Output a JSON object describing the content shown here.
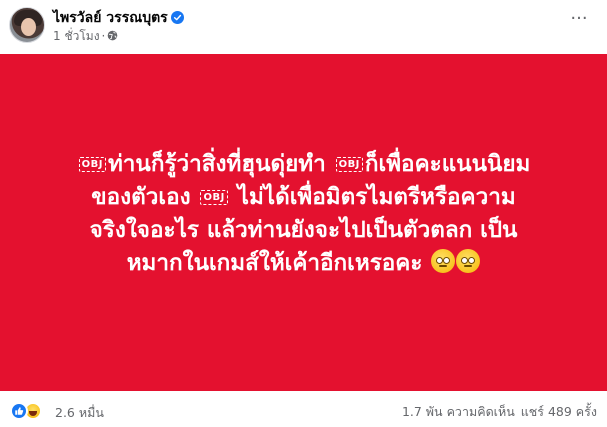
{
  "post": {
    "author": "ไพรวัลย์ วรรณบุตร",
    "timestamp": "1 ชั่วโมง",
    "separator": "·",
    "more_label": "···"
  },
  "body": {
    "background_color": "#e4112f",
    "text_color": "#ffffff",
    "placeholder_glyph": "OBJ",
    "segments": [
      "ท่านก็รู้ว่าสิ่งที่ฮุนดุ่ยทำ",
      "ก็เพื่อคะแนนนิยม",
      "ของตัวเอง",
      "ไม่ได้เพื่อมิตรไมตรีหรือความ",
      "จริงใจอะไร แล้วท่านยังจะไปเป็นตัวตลก เป็น",
      "หมากในเกมส์ให้เค้าอีกเหรอคะ"
    ],
    "emojis": [
      "face-with-rolling-eyes-icon",
      "face-with-rolling-eyes-icon"
    ]
  },
  "footer": {
    "reaction_count": "2.6 หมื่น",
    "comments": "1.7 พัน ความคิดเห็น",
    "shares": "แชร์ 489 ครั้ง"
  },
  "colors": {
    "verified_badge": "#1877f2",
    "like_reaction": "#1877f2",
    "secondary_text": "#65676b"
  }
}
